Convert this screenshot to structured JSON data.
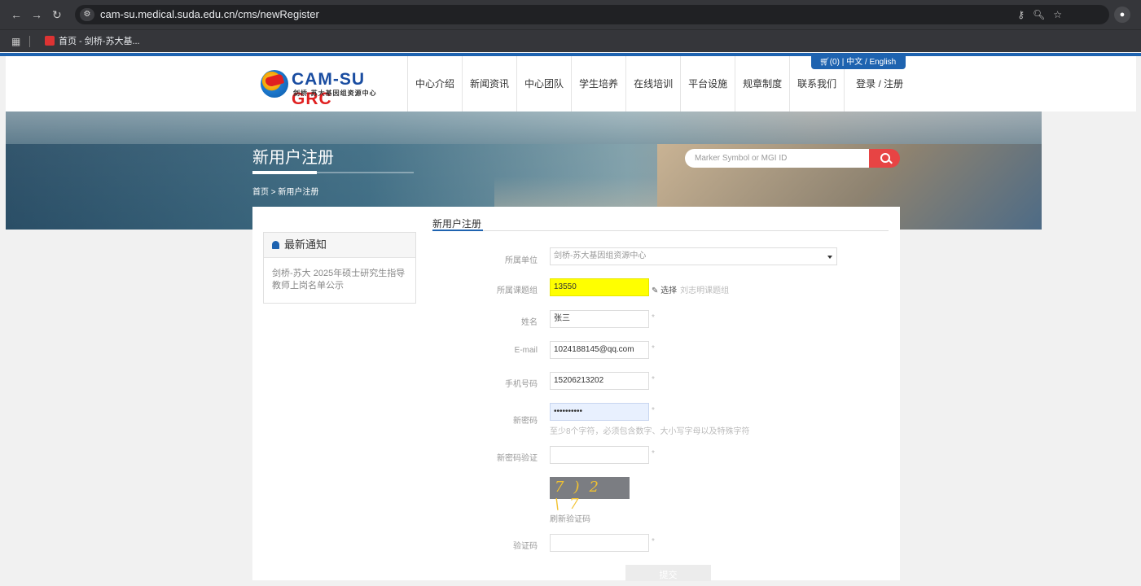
{
  "browser": {
    "url": "cam-su.medical.suda.edu.cn/cms/newRegister",
    "bookmark_label": "首页 - 剑桥-苏大基..."
  },
  "header": {
    "logo_main": "CAM-SU",
    "logo_grc": "GRC",
    "logo_sub": "剑桥-苏大基因组资源中心",
    "nav": [
      "中心介绍",
      "新闻资讯",
      "中心团队",
      "学生培养",
      "在线培训",
      "平台设施",
      "规章制度",
      "联系我们"
    ],
    "login_label": "登录 / 注册",
    "cart_label": "(0)",
    "lang_label": "中文 / English"
  },
  "banner": {
    "title": "新用户注册",
    "breadcrumb": "首页 > 新用户注册",
    "search_placeholder": "Marker Symbol or MGI ID"
  },
  "notice": {
    "title": "最新通知",
    "item": "剑桥-苏大 2025年硕士研究生指导教师上岗名单公示"
  },
  "form": {
    "section_title": "新用户注册",
    "unit_label": "所属单位",
    "unit_value": "剑桥-苏大基因组资源中心",
    "group_label": "所属课题组",
    "group_value": "13550",
    "group_pick": "选择",
    "group_name": "刘志明课题组",
    "name_label": "姓名",
    "name_value": "张三",
    "email_label": "E-mail",
    "email_value": "1024188145@qq.com",
    "phone_label": "手机号码",
    "phone_value": "15206213202",
    "pwd_label": "新密码",
    "pwd_value": "••••••••••",
    "pwd_hint": "至少8个字符，必须包含数字、大小写字母以及特殊字符",
    "pwd2_label": "新密码验证",
    "captcha_text": "7)2 \\7",
    "refresh_label": "刷新验证码",
    "code_label": "验证码",
    "required_mark": "*",
    "submit_label": "提交"
  },
  "colors": {
    "brand_blue": "#1e63b0",
    "search_red": "#e74444",
    "highlight_yellow": "#ffff00",
    "autofill_blue": "#e8f0fe"
  }
}
